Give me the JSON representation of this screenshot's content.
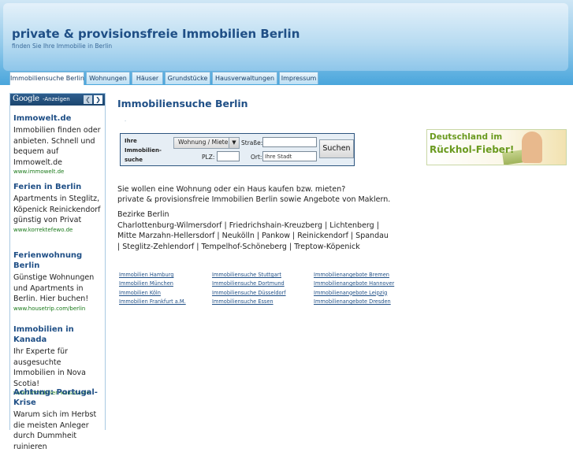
{
  "header": {
    "title": "private & provisionsfreie Immobilien Berlin",
    "subtitle": "finden Sie Ihre Immobilie in Berlin"
  },
  "nav": {
    "tabs": [
      {
        "label": "Immobiliensuche Berlin",
        "active": true
      },
      {
        "label": "Wohnungen",
        "active": false
      },
      {
        "label": "Häuser",
        "active": false
      },
      {
        "label": "Grundstücke",
        "active": false
      },
      {
        "label": "Hausverwaltungen",
        "active": false
      },
      {
        "label": "Impressum",
        "active": false
      }
    ]
  },
  "ads": {
    "logo": "Google",
    "label": "-Anzeigen",
    "prev_icon": "chevron-left-icon",
    "next_icon": "chevron-right-icon",
    "items": [
      {
        "title": "Immowelt.de",
        "text": "Immobilien finden oder anbieten. Schnell und bequem auf Immowelt.de",
        "url": "www.immowelt.de"
      },
      {
        "title": "Ferien in Berlin",
        "text": "Apartments in Steglitz, Köpenick Reinickendorf günstig von Privat",
        "url": "www.korrektefewo.de"
      },
      {
        "title": "Ferienwohnung Berlin",
        "text": "Günstige Wohnungen und Apartments in Berlin. Hier buchen!",
        "url": "www.housetrip.com/berlin"
      },
      {
        "title": "Immobilien in Kanada",
        "text": "Ihr Experte für ausgesuchte Immobilien in Nova Scotia!",
        "url": "www.immobilien-kanada.de"
      },
      {
        "title": "Achtung: Portugal-Krise",
        "text": "Warum sich im Herbst die meisten Anleger durch Dummheit ruinieren",
        "url": ""
      }
    ]
  },
  "main": {
    "title": "Immobiliensuche Berlin",
    "dot": "-",
    "search": {
      "label": "Ihre Immobilien-suche",
      "type_value": "Wohnung / Miete",
      "street_label": "Straße:",
      "street_value": "",
      "plz_label": "PLZ:",
      "plz_value": "",
      "city_label": "Ort:",
      "city_value": "Ihre Stadt",
      "button": "Suchen"
    },
    "banner": {
      "line1": "Deutschland im",
      "line2": "Rückhol-Fieber!"
    },
    "intro_line1": "Sie wollen eine Wohnung oder ein Haus kaufen bzw. mieten?",
    "intro_line2": "private & provisionsfreie Immobilien Berlin sowie Angebote von Maklern.",
    "districts_heading": "Bezirke Berlin",
    "districts_text": "Charlottenburg-Wilmersdorf | Friedrichshain-Kreuzberg | Lichtenberg | Mitte Marzahn-Hellersdorf | Neukölln | Pankow | Reinickendorf | Spandau | Steglitz-Zehlendorf | Tempelhof-Schöneberg | Treptow-Köpenick",
    "links": {
      "col1": [
        "Immobilien Hamburg",
        "Immobilien München",
        "Immobilien Köln",
        "Immobilien Frankfurt a.M."
      ],
      "col2": [
        "Immobiliensuche Stuttgart",
        "Immobiliensuche Dortmund",
        "Immobiliensuche Düsseldorf",
        "Immobiliensuche Essen"
      ],
      "col3": [
        "Immobilienangebote Bremen",
        "Immobilienangebote Hannover",
        "Immobilienangebote Leipzig",
        "Immobilienangebote Dresden"
      ]
    }
  }
}
